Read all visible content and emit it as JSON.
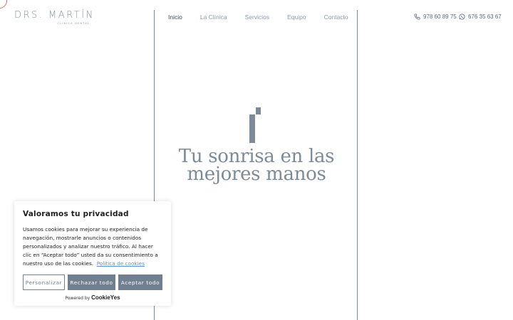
{
  "brand": {
    "name": "DRS. MARTÍN",
    "tagline": "CLÍNICA DENTAL"
  },
  "nav": {
    "items": [
      {
        "label": "Inicio",
        "active": true
      },
      {
        "label": "La Clínica",
        "active": false
      },
      {
        "label": "Servicios",
        "active": false
      },
      {
        "label": "Equipo",
        "active": false
      },
      {
        "label": "Contacto",
        "active": false
      }
    ]
  },
  "contact": {
    "phone": "978 60 89 75",
    "whatsapp": "676 35 63 67",
    "phone_icon": "phone-icon",
    "whatsapp_icon": "whatsapp-icon"
  },
  "hero": {
    "title": "Tu sonrisa en las mejores manos"
  },
  "cookie": {
    "title": "Valoramos tu privacidad",
    "body": "Usamos cookies para mejorar su experiencia de navegación, mostrarle anuncios o contenidos personalizados y analizar nuestro tráfico. Al hacer clic en “Aceptar todo” usted da su consentimiento a nuestro uso de las cookies.",
    "policy_link": "Política de cookies",
    "customize_label": "Personalizar",
    "reject_label": "Rechazar todo",
    "accept_label": "Aceptar todo",
    "powered_by": "Powered by",
    "powered_brand": "CookieYes"
  },
  "colors": {
    "accent": "#708090",
    "link": "#5b8fcf",
    "nav_active": "#3f4a56",
    "corner": "#e06a5d"
  }
}
